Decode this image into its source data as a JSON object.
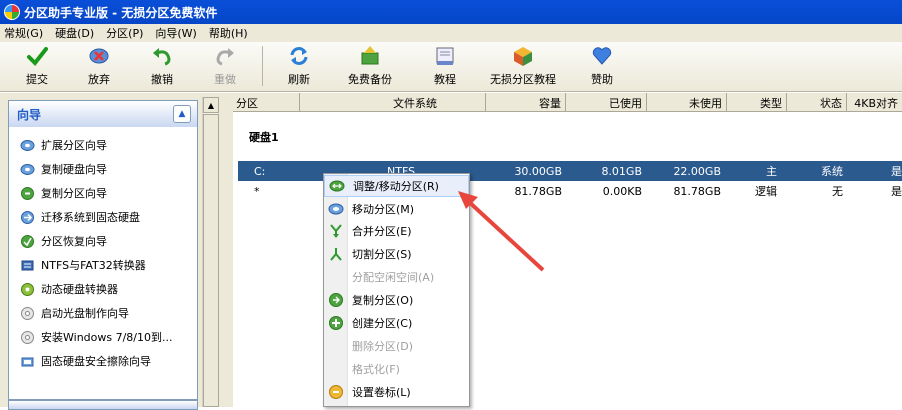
{
  "window": {
    "title": "分区助手专业版 - 无损分区免费软件"
  },
  "menu": {
    "items": [
      "常规(G)",
      "硬盘(D)",
      "分区(P)",
      "向导(W)",
      "帮助(H)"
    ]
  },
  "toolbar": {
    "submit": "提交",
    "discard": "放弃",
    "undo": "撤销",
    "redo": "重做",
    "refresh": "刷新",
    "backup": "免费备份",
    "tutorial": "教程",
    "lossless_tutorial": "无损分区教程",
    "sponsor": "赞助"
  },
  "wizard": {
    "title": "向导",
    "items": [
      "扩展分区向导",
      "复制硬盘向导",
      "复制分区向导",
      "迁移系统到固态硬盘",
      "分区恢复向导",
      "NTFS与FAT32转换器",
      "动态硬盘转换器",
      "启动光盘制作向导",
      "安装Windows 7/8/10到...",
      "固态硬盘安全擦除向导"
    ]
  },
  "table": {
    "columns": [
      "分区",
      "文件系统",
      "容量",
      "已使用",
      "未使用",
      "类型",
      "状态",
      "4KB对齐"
    ],
    "disk_label": "硬盘1",
    "rows": [
      {
        "partition": "C:",
        "fs": "NTFS",
        "capacity": "30.00GB",
        "used": "8.01GB",
        "free": "22.00GB",
        "type": "主",
        "status": "系统",
        "align": "是"
      },
      {
        "partition": "*",
        "fs": "",
        "capacity": "81.78GB",
        "used": "0.00KB",
        "free": "81.78GB",
        "type": "逻辑",
        "status": "无",
        "align": "是"
      }
    ]
  },
  "context_menu": {
    "items": [
      {
        "label": "调整/移动分区(R)",
        "enabled": true
      },
      {
        "label": "移动分区(M)",
        "enabled": true
      },
      {
        "label": "合并分区(E)",
        "enabled": true
      },
      {
        "label": "切割分区(S)",
        "enabled": true
      },
      {
        "label": "分配空闲空间(A)",
        "enabled": false
      },
      {
        "label": "复制分区(O)",
        "enabled": true
      },
      {
        "label": "创建分区(C)",
        "enabled": true
      },
      {
        "label": "删除分区(D)",
        "enabled": false
      },
      {
        "label": "格式化(F)",
        "enabled": false
      },
      {
        "label": "设置卷标(L)",
        "enabled": true
      }
    ]
  },
  "colors": {
    "title_bar": "#0546c8",
    "selection": "#2b5a8f",
    "annotation_arrow": "#e8463c"
  }
}
